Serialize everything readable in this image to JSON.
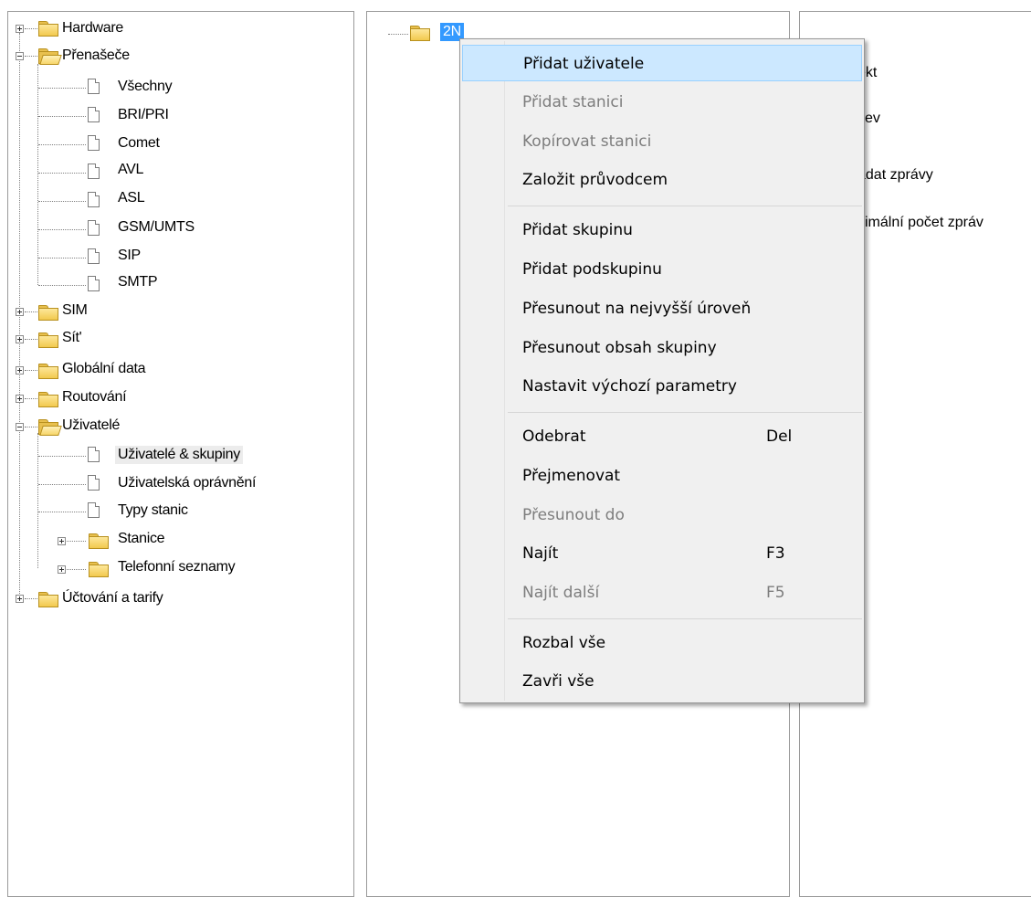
{
  "left_tree": {
    "items": [
      {
        "label": "Hardware"
      },
      {
        "label": "Přenašeče"
      },
      {
        "label": "Všechny"
      },
      {
        "label": "BRI/PRI"
      },
      {
        "label": "Comet"
      },
      {
        "label": "AVL"
      },
      {
        "label": "ASL"
      },
      {
        "label": "GSM/UMTS"
      },
      {
        "label": "SIP"
      },
      {
        "label": "SMTP"
      },
      {
        "label": "SIM"
      },
      {
        "label": "Sít'"
      },
      {
        "label": "Globální data"
      },
      {
        "label": "Routování"
      },
      {
        "label": "Uživatelé"
      },
      {
        "label": "Uživatelé & skupiny"
      },
      {
        "label": "Uživatelská oprávnění"
      },
      {
        "label": "Typy stanic"
      },
      {
        "label": "Stanice"
      },
      {
        "label": "Telefonní seznamy"
      },
      {
        "label": "Účtování a tarify"
      }
    ]
  },
  "mid_tree": {
    "root_label": "2N"
  },
  "right_panel": {
    "labels": [
      "ekt",
      "zev",
      "ádat zprávy",
      "ximální počet zpráv"
    ]
  },
  "context_menu": {
    "items": [
      {
        "label": "Přidat uživatele",
        "key": ""
      },
      {
        "label": "Přidat stanici",
        "key": ""
      },
      {
        "label": "Kopírovat stanici",
        "key": ""
      },
      {
        "label": "Založit průvodcem",
        "key": ""
      },
      {
        "label": "Přidat skupinu",
        "key": ""
      },
      {
        "label": "Přidat podskupinu",
        "key": ""
      },
      {
        "label": "Přesunout na nejvyšší úroveň",
        "key": ""
      },
      {
        "label": "Přesunout obsah skupiny",
        "key": ""
      },
      {
        "label": "Nastavit výchozí parametry",
        "key": ""
      },
      {
        "label": "Odebrat",
        "key": "Del"
      },
      {
        "label": "Přejmenovat",
        "key": ""
      },
      {
        "label": "Přesunout do",
        "key": ""
      },
      {
        "label": "Najít",
        "key": "F3"
      },
      {
        "label": "Najít další",
        "key": "F5"
      },
      {
        "label": "Rozbal vše",
        "key": ""
      },
      {
        "label": "Zavři vše",
        "key": ""
      }
    ]
  }
}
